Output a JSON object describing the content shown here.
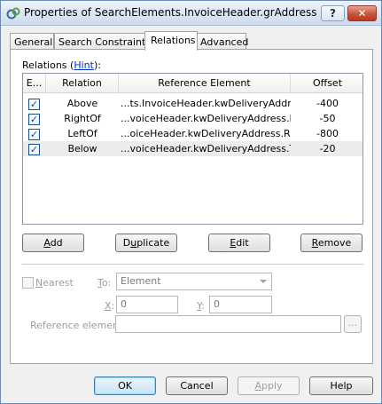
{
  "window": {
    "title": "Properties of SearchElements.InvoiceHeader.grAddress"
  },
  "titlebar": {
    "help_glyph": "?",
    "close_glyph": "✕"
  },
  "tabs": [
    {
      "label": "General"
    },
    {
      "label": "Search Constraints"
    },
    {
      "label": "Relations",
      "active": true
    },
    {
      "label": "Advanced"
    }
  ],
  "relations": {
    "label_prefix": "Relations (",
    "hint_link": "Hint",
    "label_suffix": "):",
    "columns": {
      "enabled": "E...",
      "relation": "Relation",
      "reference": "Reference Element",
      "offset": "Offset"
    },
    "rows": [
      {
        "enabled": true,
        "relation": "Above",
        "reference": "...ts.InvoiceHeader.kwDeliveryAddress",
        "offset": "-400"
      },
      {
        "enabled": true,
        "relation": "RightOf",
        "reference": "...voiceHeader.kwDeliveryAddress.Left",
        "offset": "-50"
      },
      {
        "enabled": true,
        "relation": "LeftOf",
        "reference": "...oiceHeader.kwDeliveryAddress.Right",
        "offset": "-800"
      },
      {
        "enabled": true,
        "relation": "Below",
        "reference": "...voiceHeader.kwDeliveryAddress.Top",
        "offset": "-20",
        "selected": true
      }
    ],
    "checkmark": "✓"
  },
  "actions": {
    "add": {
      "accel": "A",
      "rest": "dd"
    },
    "duplicate": {
      "pre": "D",
      "accel": "u",
      "rest": "plicate"
    },
    "edit": {
      "accel": "E",
      "rest": "dit"
    },
    "remove": {
      "accel": "R",
      "rest": "emove"
    }
  },
  "editor": {
    "nearest": {
      "accel": "N",
      "rest": "earest"
    },
    "to_label": {
      "accel": "T",
      "rest": "o:"
    },
    "to_value": "Element",
    "x_label": {
      "accel": "X",
      "rest": ":"
    },
    "x_value": "0",
    "y_label": {
      "accel": "Y",
      "rest": ":"
    },
    "y_value": "0",
    "reference_label": "Reference element:",
    "reference_value": "",
    "browse_label": "..."
  },
  "footer": {
    "ok": "OK",
    "cancel": "Cancel",
    "apply": {
      "accel": "A",
      "rest": "pply"
    },
    "help": "Help"
  }
}
